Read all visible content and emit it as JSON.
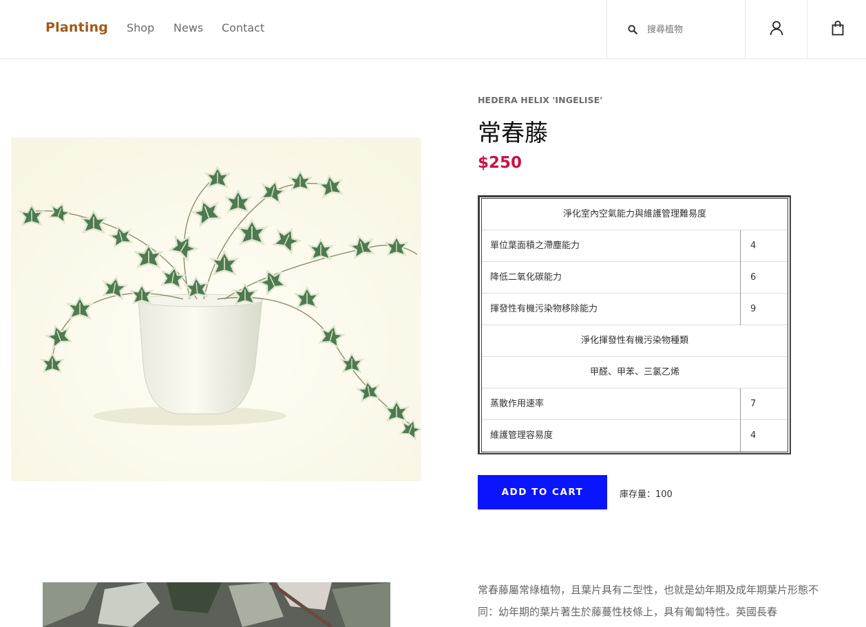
{
  "header": {
    "brand": "Planting",
    "nav": [
      {
        "label": "Shop"
      },
      {
        "label": "News"
      },
      {
        "label": "Contact"
      }
    ],
    "search": {
      "placeholder": "搜尋植物",
      "icon": "search-icon"
    },
    "user_icon": "user-icon",
    "cart_icon": "shopping-bag-icon"
  },
  "product": {
    "latin_name": "HEDERA HELIX 'INGELISE'",
    "name": "常春藤",
    "price": "$250",
    "spec_table": {
      "header": "淨化室內空氣能力與維護管理難易度",
      "rows_a": [
        {
          "label": "單位葉面積之滯塵能力",
          "value": "4"
        },
        {
          "label": "降低二氧化碳能力",
          "value": "6"
        },
        {
          "label": "揮發性有機污染物移除能力",
          "value": "9"
        }
      ],
      "subheader": "淨化揮發性有機污染物種類",
      "pollutants": "甲醛、甲苯、三氯乙烯",
      "rows_b": [
        {
          "label": "蒸散作用速率",
          "value": "7"
        },
        {
          "label": "維護管理容易度",
          "value": "4"
        }
      ]
    },
    "add_to_cart": "ADD TO CART",
    "stock": "庫存量：100",
    "description": "常春藤屬常綠植物，且葉片具有二型性，也就是幼年期及成年期葉片形態不 同：幼年期的葉片著生於藤蔓性枝條上，具有匍匐特性。英國長春"
  },
  "colors": {
    "brand": "#a0591a",
    "price": "#cc1048",
    "button": "#0a14ff"
  }
}
